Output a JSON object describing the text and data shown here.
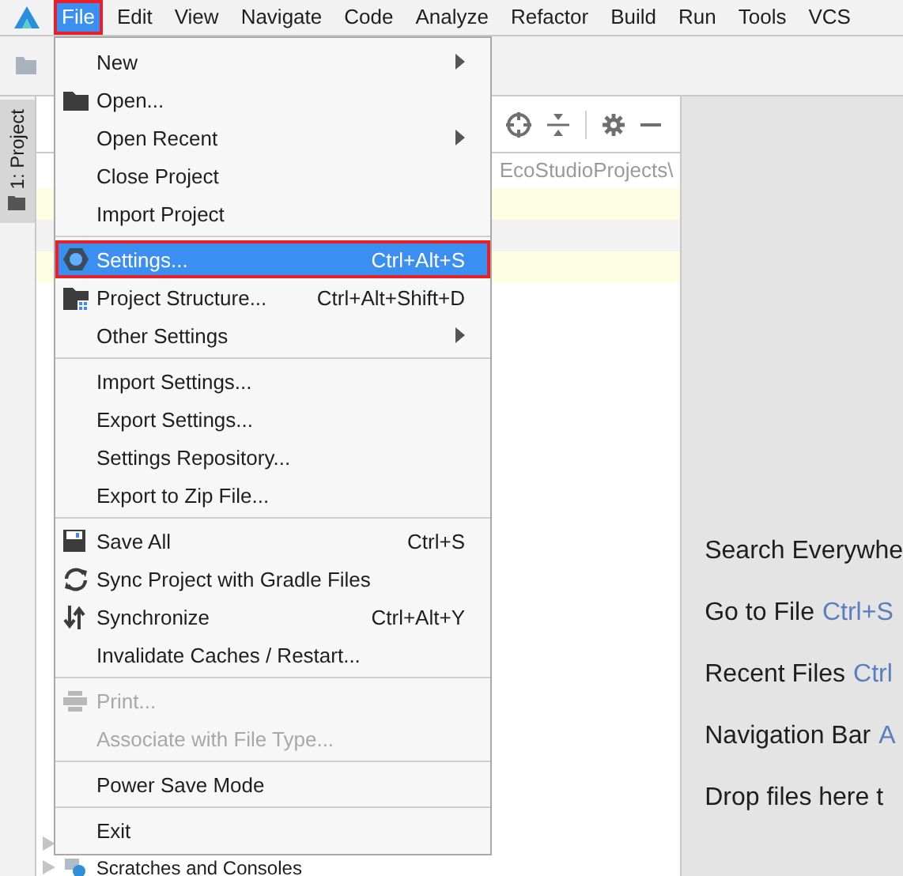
{
  "menu_bar": [
    {
      "label": "File",
      "selected": true,
      "annotated": true
    },
    {
      "label": "Edit",
      "selected": false,
      "annotated": false
    },
    {
      "label": "View",
      "selected": false,
      "annotated": false
    },
    {
      "label": "Navigate",
      "selected": false,
      "annotated": false
    },
    {
      "label": "Code",
      "selected": false,
      "annotated": false
    },
    {
      "label": "Analyze",
      "selected": false,
      "annotated": false
    },
    {
      "label": "Refactor",
      "selected": false,
      "annotated": false
    },
    {
      "label": "Build",
      "selected": false,
      "annotated": false
    },
    {
      "label": "Run",
      "selected": false,
      "annotated": false
    },
    {
      "label": "Tools",
      "selected": false,
      "annotated": false
    },
    {
      "label": "VCS",
      "selected": false,
      "annotated": false
    }
  ],
  "tool_strip": {
    "tab": "1: Project"
  },
  "project_panel": {
    "path": "EcoStudioProjects\\",
    "bottom_row": "Scratches and Consoles"
  },
  "file_menu": {
    "groups": [
      [
        {
          "label": "New",
          "submenu": true,
          "selected": false,
          "annotated": false,
          "disabled": false
        },
        {
          "label": "Open...",
          "submenu": false,
          "selected": false,
          "annotated": false,
          "disabled": false
        },
        {
          "label": "Open Recent",
          "submenu": true,
          "selected": false,
          "annotated": false,
          "disabled": false
        },
        {
          "label": "Close Project",
          "submenu": false,
          "selected": false,
          "annotated": false,
          "disabled": false
        },
        {
          "label": "Import Project",
          "submenu": false,
          "selected": false,
          "annotated": false,
          "disabled": false
        }
      ],
      [
        {
          "label": "Settings...",
          "shortcut": "Ctrl+Alt+S",
          "submenu": false,
          "selected": true,
          "annotated": true,
          "disabled": false
        },
        {
          "label": "Project Structure...",
          "shortcut": "Ctrl+Alt+Shift+D",
          "submenu": false,
          "selected": false,
          "annotated": false,
          "disabled": false
        },
        {
          "label": "Other Settings",
          "submenu": true,
          "selected": false,
          "annotated": false,
          "disabled": false
        }
      ],
      [
        {
          "label": "Import Settings...",
          "submenu": false,
          "selected": false,
          "annotated": false,
          "disabled": false
        },
        {
          "label": "Export Settings...",
          "submenu": false,
          "selected": false,
          "annotated": false,
          "disabled": false
        },
        {
          "label": "Settings Repository...",
          "submenu": false,
          "selected": false,
          "annotated": false,
          "disabled": false
        },
        {
          "label": "Export to Zip File...",
          "submenu": false,
          "selected": false,
          "annotated": false,
          "disabled": false
        }
      ],
      [
        {
          "label": "Save All",
          "shortcut": "Ctrl+S",
          "submenu": false,
          "selected": false,
          "annotated": false,
          "disabled": false
        },
        {
          "label": "Sync Project with Gradle Files",
          "submenu": false,
          "selected": false,
          "annotated": false,
          "disabled": false
        },
        {
          "label": "Synchronize",
          "shortcut": "Ctrl+Alt+Y",
          "submenu": false,
          "selected": false,
          "annotated": false,
          "disabled": false
        },
        {
          "label": "Invalidate Caches / Restart...",
          "submenu": false,
          "selected": false,
          "annotated": false,
          "disabled": false
        }
      ],
      [
        {
          "label": "Print...",
          "submenu": false,
          "selected": false,
          "annotated": false,
          "disabled": true
        },
        {
          "label": "Associate with File Type...",
          "submenu": false,
          "selected": false,
          "annotated": false,
          "disabled": true
        }
      ],
      [
        {
          "label": "Power Save Mode",
          "submenu": false,
          "selected": false,
          "annotated": false,
          "disabled": false
        }
      ],
      [
        {
          "label": "Exit",
          "submenu": false,
          "selected": false,
          "annotated": false,
          "disabled": false
        }
      ]
    ]
  },
  "editor_hints": [
    {
      "label": "Search Everywhe"
    },
    {
      "label": "Go to File",
      "shortcut": "Ctrl+S"
    },
    {
      "label": "Recent Files",
      "shortcut": "Ctrl"
    },
    {
      "label": "Navigation Bar",
      "shortcut": "A"
    },
    {
      "label": "Drop files here t"
    }
  ]
}
